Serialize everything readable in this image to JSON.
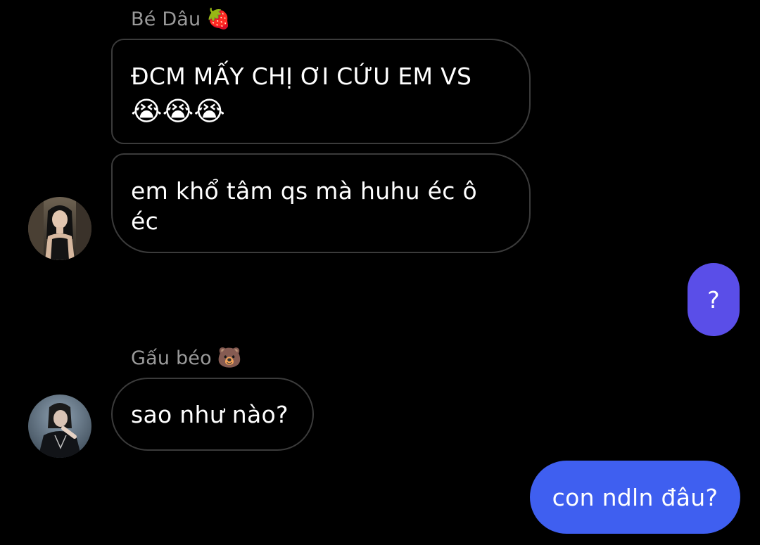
{
  "messages": {
    "group1": {
      "sender_name": "Bé Dâu",
      "sender_emoji": "🍓",
      "bubble1_text": "ĐCM MẤY CHỊ ƠI CỨU EM VS",
      "bubble1_emojis": "😭😭😭",
      "bubble2_text": "em khổ tâm qs mà huhu éc ô éc"
    },
    "outgoing1": {
      "text": "?"
    },
    "group2": {
      "sender_name": "Gấu béo",
      "sender_emoji": "🐻",
      "bubble_text": "sao như nào?"
    },
    "outgoing2": {
      "text": "con ndln đâu?"
    }
  },
  "colors": {
    "background": "#000000",
    "incoming_border": "#3b3b3b",
    "outgoing_top": "#5a4ee8",
    "outgoing_bottom": "#3f5ff0",
    "sender_name": "#9a9a9a"
  }
}
